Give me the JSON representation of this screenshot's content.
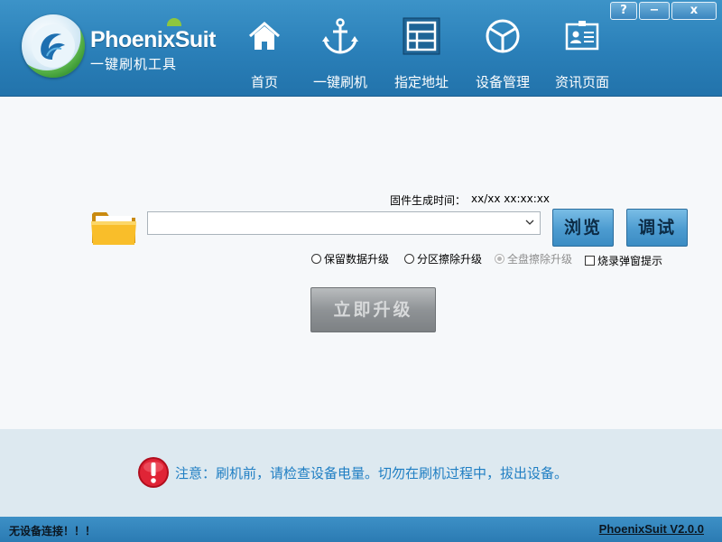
{
  "app": {
    "brand": "PhoenixSuit",
    "subtitle": "一键刷机工具",
    "version_link": "PhoenixSuit V2.0.0"
  },
  "window_controls": {
    "help": "?",
    "minimize": "−",
    "close": "x"
  },
  "nav": {
    "items": [
      {
        "label": "首页",
        "icon": "home-icon"
      },
      {
        "label": "一键刷机",
        "icon": "anchor-icon"
      },
      {
        "label": "指定地址",
        "icon": "grid-icon"
      },
      {
        "label": "设备管理",
        "icon": "cube-icon"
      },
      {
        "label": "资讯页面",
        "icon": "id-card-icon"
      }
    ]
  },
  "firmware": {
    "build_time_label": "固件生成时间：",
    "build_time_value": "xx/xx xx:xx:xx",
    "path_value": "",
    "browse_label": "浏览",
    "debug_label": "调试"
  },
  "options": {
    "keep_data": "保留数据升级",
    "partition_erase": "分区擦除升级",
    "full_erase": "全盘擦除升级",
    "popup_hint": "烧录弹窗提示"
  },
  "upgrade_button": "立即升级",
  "notice": {
    "text": "注意：刷机前，请检查设备电量。切勿在刷机过程中，拔出设备。"
  },
  "status": {
    "device": "无设备连接！！！"
  },
  "colors": {
    "header_blue": "#2a7fb8",
    "notice_text": "#1f7ec3",
    "warn_red": "#d8192d"
  }
}
